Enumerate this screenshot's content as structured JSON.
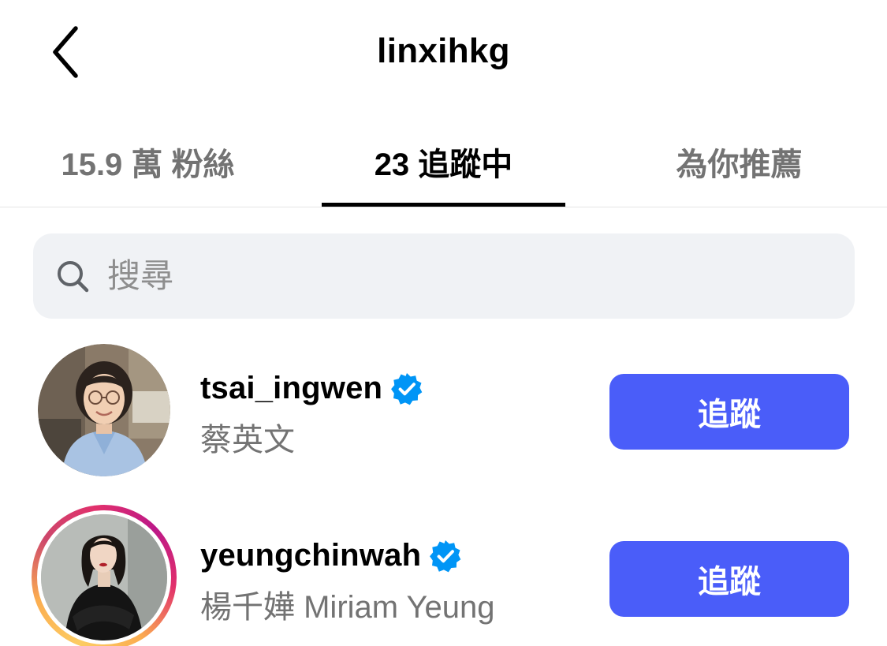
{
  "header": {
    "title": "linxihkg",
    "back_icon": "chevron-left-icon"
  },
  "tabs": [
    {
      "label": "15.9 萬 粉絲",
      "active": false
    },
    {
      "label": "23 追蹤中",
      "active": true
    },
    {
      "label": "為你推薦",
      "active": false
    }
  ],
  "search": {
    "placeholder": "搜尋",
    "value": "",
    "icon": "search-icon"
  },
  "colors": {
    "accent": "#4a5df9",
    "verified": "#0095f6",
    "secondary_text": "#737373",
    "search_bg": "#f0f2f5"
  },
  "users": [
    {
      "username": "tsai_ingwen",
      "full_name": "蔡英文",
      "verified": true,
      "has_story": false,
      "button_label": "追蹤"
    },
    {
      "username": "yeungchinwah",
      "full_name": "楊千嬅 Miriam Yeung",
      "verified": true,
      "has_story": true,
      "button_label": "追蹤"
    }
  ]
}
